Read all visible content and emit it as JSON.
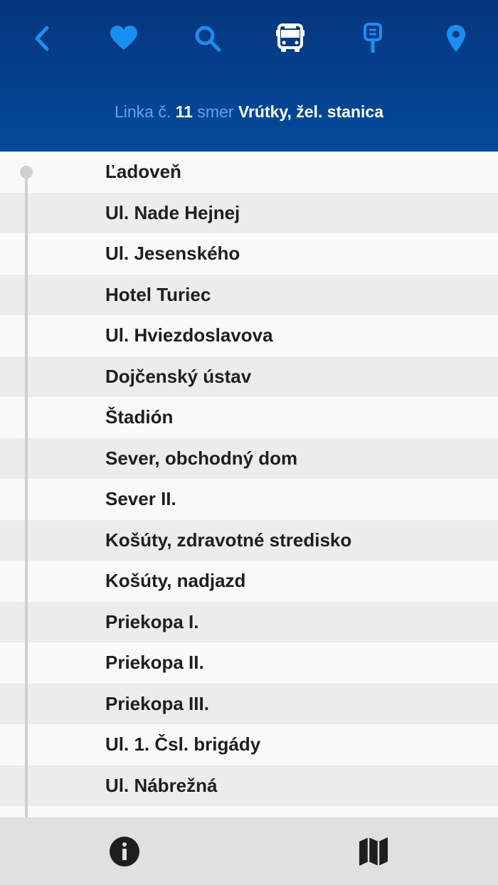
{
  "nav": {
    "icons": [
      "back-icon",
      "favorites-heart-icon",
      "search-icon",
      "bus-icon",
      "bus-stop-icon",
      "location-pin-icon"
    ],
    "icon_color": "#1b8ef2",
    "active_icon_color": "#ffffff"
  },
  "header": {
    "line_prefix": "Linka č.",
    "line_number": "11",
    "direction_prefix": "smer",
    "destination": "Vrútky, žel. stanica"
  },
  "stops": [
    "Ľadoveň",
    "Ul. Nade Hejnej",
    "Ul. Jesenského",
    "Hotel Turiec",
    "Ul. Hviezdoslavova",
    "Dojčenský ústav",
    "Štadión",
    "Sever, obchodný dom",
    "Sever II.",
    "Košúty, zdravotné stredisko",
    "Košúty, nadjazd",
    "Priekopa I.",
    "Priekopa II.",
    "Priekopa III.",
    "Ul. 1. Čsl. brigády",
    "Ul. Nábrežná",
    ""
  ],
  "footer": {
    "icons": [
      "info-icon",
      "map-icon"
    ]
  },
  "colors": {
    "header_top": "#05367e",
    "header_bottom": "#034a9a",
    "title_accent": "#5aa6f0"
  }
}
